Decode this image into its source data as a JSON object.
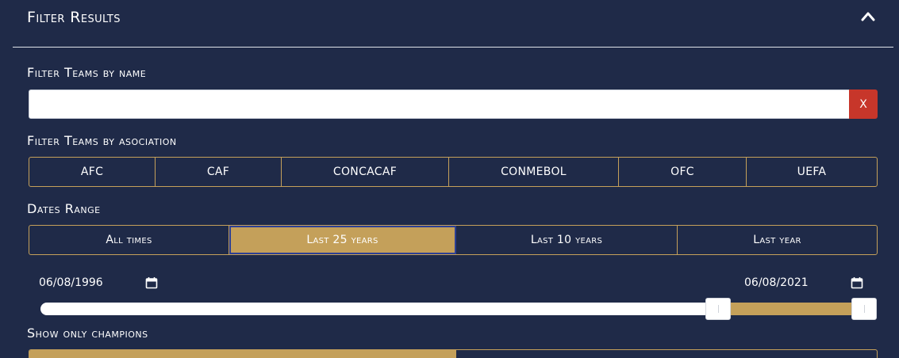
{
  "header": {
    "title": "Filter Results",
    "collapse_icon": "chevron-up-icon"
  },
  "name_filter": {
    "label": "Filter Teams by name",
    "value": "",
    "placeholder": "",
    "clear_label": "X"
  },
  "association_filter": {
    "label": "Filter Teams by asociation",
    "options": [
      "AFC",
      "CAF",
      "CONCACAF",
      "CONMEBOL",
      "OFC",
      "UEFA"
    ]
  },
  "dates": {
    "label": "Dates Range",
    "options": [
      "All times",
      "Last 25 years",
      "Last 10 years",
      "Last year"
    ],
    "selected": "Last 25 years",
    "start_date": "06/08/1996",
    "end_date": "06/08/2021",
    "range_start_fraction": 0.82,
    "range_end_fraction": 1.0
  },
  "champions": {
    "label": "Show only champions"
  },
  "colors": {
    "background": "#1f2a48",
    "accent": "#c4a05a",
    "clear_button": "#c7362a",
    "focus_outline": "#2c3f94"
  }
}
